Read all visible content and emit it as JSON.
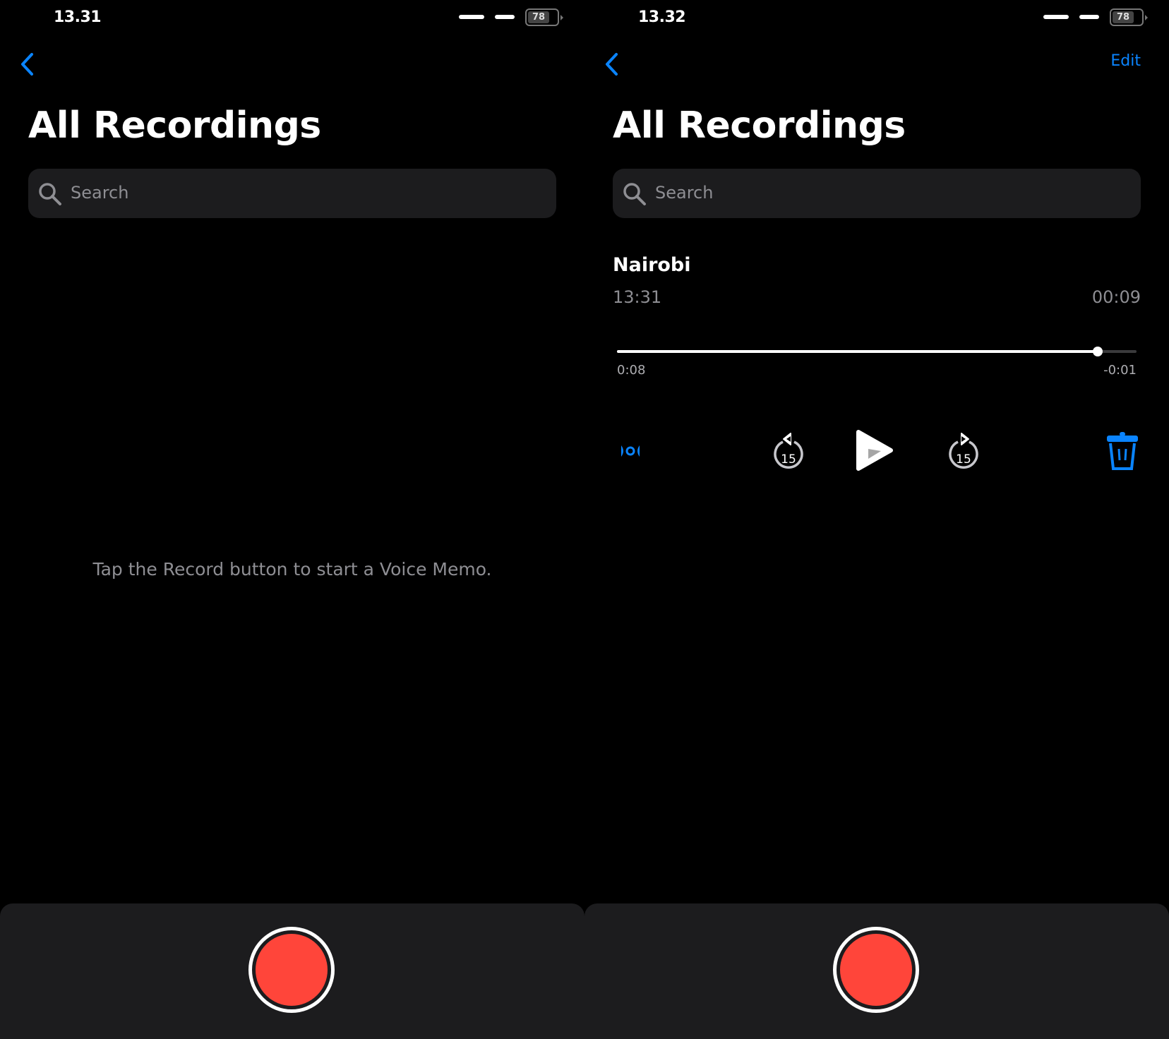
{
  "left": {
    "status": {
      "time": "13.31",
      "battery": "78"
    },
    "title": "All Recordings",
    "search": {
      "placeholder": "Search"
    },
    "empty_message": "Tap the Record button to start a Voice Memo."
  },
  "right": {
    "status": {
      "time": "13.32",
      "battery": "78"
    },
    "edit_label": "Edit",
    "title": "All Recordings",
    "search": {
      "placeholder": "Search"
    },
    "recording": {
      "name": "Nairobi",
      "date": "13:31",
      "duration": "00:09",
      "elapsed": "0:08",
      "remaining": "-0:01",
      "progress": 0.925,
      "skip_seconds": "15"
    }
  },
  "colors": {
    "accent": "#0a84ff",
    "record": "#ff453a",
    "bar": "#1c1c1e"
  }
}
